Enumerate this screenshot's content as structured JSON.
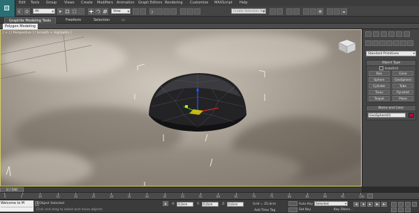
{
  "menu": {
    "items": [
      "Edit",
      "Tools",
      "Group",
      "Views",
      "Create",
      "Modifiers",
      "Animation",
      "Graph Editors",
      "Rendering",
      "Customize",
      "MAXScript",
      "Help"
    ]
  },
  "toolbar": {
    "selection_filter": "All",
    "reference_coord": "View",
    "named_selection_placeholder": "Create Selection Set"
  },
  "ribbon": {
    "tabs": [
      "Graphite Modeling Tools",
      "Freeform",
      "Selection"
    ],
    "active_tab": "Graphite Modeling Tools",
    "sub_tab": "Polygon Modeling"
  },
  "viewport": {
    "label_parts": [
      "[ + ]",
      "[ Perspective ]",
      "[ Smooth + Highlights ]"
    ],
    "object": "geosphere-hemisphere"
  },
  "command_panel": {
    "category_dropdown": "Standard Primitives",
    "object_type": {
      "header": "Object Type",
      "autogrid": "AutoGrid",
      "buttons": [
        "Box",
        "Cone",
        "Sphere",
        "GeoSphere",
        "Cylinder",
        "Tube",
        "Torus",
        "Pyramid",
        "Teapot",
        "Plane"
      ]
    },
    "name_and_color": {
      "header": "Name and Color",
      "name": "GeoSphere01",
      "color": "#a0143c"
    }
  },
  "timeline": {
    "frame_display": "0 / 100",
    "ticks": [
      "0",
      "5",
      "10",
      "15",
      "20",
      "25",
      "30",
      "35",
      "40",
      "45",
      "50",
      "55",
      "60",
      "65",
      "70",
      "75",
      "80",
      "85",
      "90",
      "95",
      "100"
    ]
  },
  "status": {
    "maxscript_line1": "Welcome to M",
    "maxscript_line2": "",
    "selection_info": "1 Object Selected",
    "prompt": "Click and drag to select and move objects",
    "x_label": "X:",
    "x_value": "0,0cm",
    "y_label": "Y:",
    "y_value": "0,0cm",
    "z_label": "Z:",
    "z_value": "0,0cm",
    "grid": "Grid = 25,4cm",
    "auto_key": "Auto Key",
    "set_key": "Set Key",
    "key_mode": "Selected",
    "add_time_tag": "Add Time Tag",
    "key_filters": "Key Filters..."
  },
  "colors": {
    "viewport_border": "#d8d060",
    "logo_bg": "#2a6f74",
    "object_color": "#a0143c"
  }
}
